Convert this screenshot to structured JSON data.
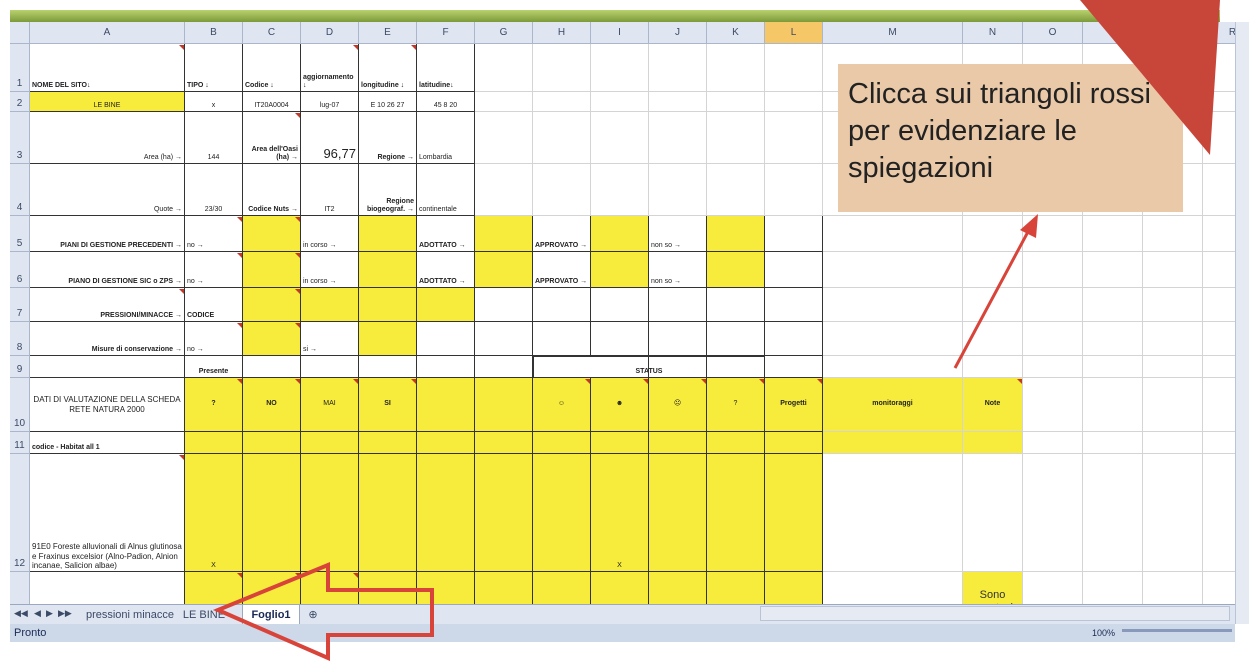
{
  "columns": [
    "A",
    "B",
    "C",
    "D",
    "E",
    "F",
    "G",
    "H",
    "I",
    "J",
    "K",
    "L",
    "M",
    "N",
    "O",
    "P",
    "Q",
    "R"
  ],
  "rows": [
    "1",
    "2",
    "3",
    "4",
    "5",
    "6",
    "7",
    "8",
    "9",
    "10",
    "11",
    "12"
  ],
  "cells": {
    "A1": "NOME DEL SITO↓",
    "B1": "TIPO ↓",
    "C1": "Codice ↓",
    "D1": "aggiornamento ↓",
    "E1": "longitudine ↓",
    "F1": "latitudine↓",
    "A2": "LE BINE",
    "B2": "x",
    "C2": "IT20A0004",
    "D2": "lug-07",
    "E2": "E 10 26 27",
    "F2": "45 8 20",
    "A3": "Area (ha) →",
    "B3": "144",
    "C3": "Area dell'Oasi (ha) →",
    "D3": "96,77",
    "E3": "Regione →",
    "F3": "Lombardia",
    "A4": "Quote →",
    "B4": "23/30",
    "C4": "Codice Nuts →",
    "D4": "IT2",
    "E4": "Regione biogeograf. →",
    "F4": "continentale",
    "A5": "PIANI DI GESTIONE PRECEDENTI →",
    "B5": "no →",
    "D5": "in corso →",
    "F5": "ADOTTATO →",
    "H5": "APPROVATO →",
    "J5": "non so →",
    "A6": "PIANO DI GESTIONE SIC o ZPS →",
    "B6": "no →",
    "D6": "in corso →",
    "F6": "ADOTTATO →",
    "H6": "APPROVATO →",
    "J6": "non so →",
    "A7": "PRESSIONI/MINACCE →",
    "B7": "CODICE",
    "A8": "Misure di conservazione →",
    "B8": "no →",
    "D8": "si →",
    "B9": "Presente",
    "H9": "STATUS",
    "A10": "DATI DI VALUTAZIONE DELLA SCHEDA RETE NATURA 2000",
    "B10": "?",
    "C10": "NO",
    "D10": "MAI",
    "E10": "SI",
    "H10": "☺",
    "I10": "☻",
    "J10": "☹",
    "K10": "?",
    "L10": "Progetti",
    "M10": "monitoraggi",
    "N10": "Note",
    "A11": "codice - Habitat all 1",
    "A12": "91E0 Foreste alluvionali di Alnus glutinosa e Fraxinus excelsior (Alno-Padion, Alnion incanae, Salicion albae)",
    "B12": "X",
    "I12": "X",
    "N13": "Sono vegetazi"
  },
  "callout": {
    "text": "Clicca sui triangoli rossi per evidenziare le spiegazioni"
  },
  "tabs": {
    "t1": "pressioni minacce",
    "t2": "LE BINE",
    "t3": "Foglio1"
  },
  "nav_icons": [
    "first-sheet-icon",
    "prev-sheet-icon",
    "next-sheet-icon",
    "last-sheet-icon"
  ],
  "status": {
    "left": "Pronto",
    "zoom": "100%"
  },
  "colors": {
    "yellow_fill": "#f7ec3c",
    "callout": "#eac9a8",
    "arrow": "#d9443a",
    "selected_col": "#f6c766"
  }
}
